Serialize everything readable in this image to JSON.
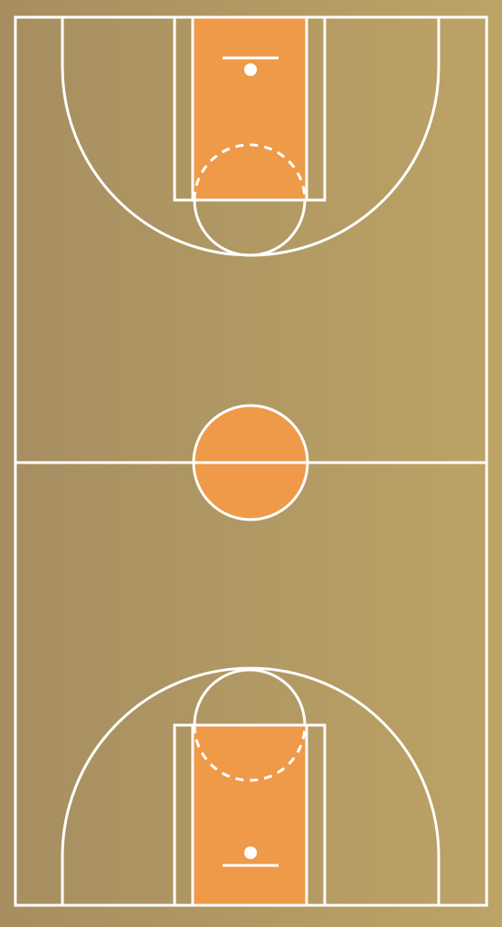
{
  "court": {
    "colors": {
      "floor_left": "#a68e61",
      "floor_right": "#bca366",
      "paint": "#ee9a48",
      "lines": "#ffffff"
    },
    "icons": {
      "top_basket": "basket-hoop-icon",
      "bottom_basket": "basket-hoop-icon"
    }
  }
}
